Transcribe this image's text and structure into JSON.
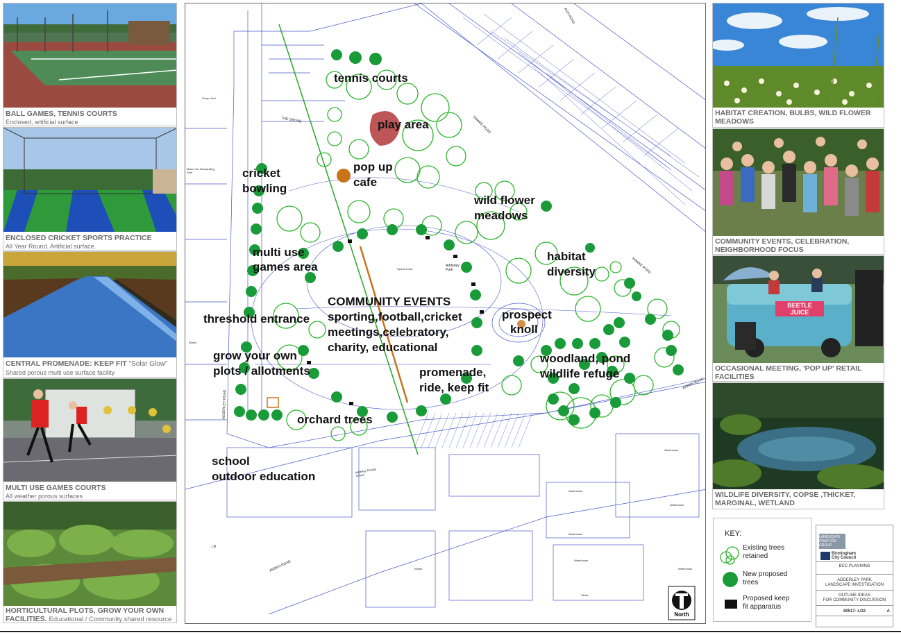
{
  "left_panels": [
    {
      "title": "BALL GAMES, TENNIS COURTS",
      "subtitle": "Enclosed, artificial surface",
      "photo": "tennis-court-photo"
    },
    {
      "title": "ENCLOSED CRICKET SPORTS PRACTICE",
      "subtitle": "All Year Round. Artificial surface.",
      "photo": "cricket-nets-photo"
    },
    {
      "title": "CENTRAL PROMENADE: KEEP FIT",
      "title_extra": "\"Solar Glow\"",
      "subtitle": "Shared porous multi use surface facility",
      "photo": "glow-path-photo"
    },
    {
      "title": "MULTI USE GAMES COURTS",
      "subtitle": "All weather porous surfaces",
      "photo": "games-court-photo"
    },
    {
      "title": "HORTICULTURAL PLOTS, GROW YOUR OWN",
      "title2": "FACILITIES.",
      "subtitle": "Educational / Community shared resource",
      "photo": "allotment-photo"
    }
  ],
  "right_panels": [
    {
      "title": "HABITAT CREATION, BULBS, WILD FLOWER",
      "title2": "MEADOWS",
      "photo": "meadow-photo"
    },
    {
      "title": "COMMUNITY EVENTS, CELEBRATION,",
      "title2": "NEIGHBORHOOD FOCUS",
      "photo": "crowd-photo"
    },
    {
      "title": "OCCASIONAL MEETING, 'POP UP' RETAIL",
      "title2": "FACILITIES",
      "photo": "juice-van-photo",
      "van_text": [
        "BEETLE",
        "JUICE"
      ]
    },
    {
      "title": "WILDLIFE DIVERSITY, COPSE ,THICKET,",
      "title2": "MARGINAL, WETLAND",
      "photo": "pond-photo"
    }
  ],
  "map": {
    "labels": [
      "tennis courts",
      "play area",
      "cricket",
      "bowling",
      "pop up",
      "cafe",
      "wild flower",
      "meadows",
      "multi use",
      "games area",
      "habitat",
      "diversity",
      "COMMUNITY EVENTS",
      "sporting,football,cricket",
      "meetings,celebratory,",
      "charity, educational",
      "threshold entrance",
      "prospect",
      "knoll",
      "grow your own",
      "plots / allotments",
      "woodland, pond",
      "wildlife refuge",
      "promenade,",
      "ride, keep fit",
      "orchard trees",
      "school",
      "outdoor education"
    ],
    "small_labels": [
      "THE GROVE",
      "Adderley Park",
      "Sports Court",
      "Adderley Primary School",
      "ARDEN ROAD",
      "ADDERLEY ROAD",
      "HAWKE ROAD",
      "ASH ROAD",
      "Warehouse",
      "Works",
      "Tanks",
      "LB",
      "Scrap Yard",
      "Motor Car Dismantling Yard",
      "Works"
    ],
    "north_label": "North"
  },
  "key": {
    "title": "KEY:",
    "items": [
      {
        "text": [
          "Existing trees",
          "retained"
        ],
        "icon": "existing-trees-icon"
      },
      {
        "text": [
          "New proposed",
          "trees"
        ],
        "icon": "new-tree-icon"
      },
      {
        "text": [
          "Proposed keep",
          "fit apparatus"
        ],
        "icon": "fit-apparatus-icon"
      }
    ]
  },
  "title_block": {
    "org1": "LANDSCAPE PRACTICE GROUP",
    "org2": "Birmingham City Council",
    "dept": "BCC PLANNING",
    "project1": "ADDERLEY PARK",
    "project2": "LANDSCAPE INVESTIGATION",
    "title1": "OUTLINE IDEAS",
    "title2": "FOR COMMUNITY DISCUSSION",
    "drawing_no": "80517- LO2",
    "revision": "A"
  },
  "colors": {
    "tree_new": "#1a9b3a",
    "tree_existing": "#2bb52b",
    "path_orange": "#c8741a",
    "road_blue": "#4b58c8"
  }
}
